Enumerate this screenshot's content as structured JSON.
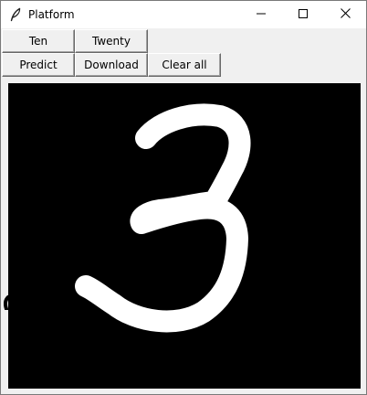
{
  "window": {
    "title": "Platform",
    "controls": {
      "minimize_icon": "minimize-icon",
      "maximize_icon": "maximize-icon",
      "close_icon": "close-icon"
    }
  },
  "buttons": {
    "ten": "Ten",
    "twenty": "Twenty",
    "predict": "Predict",
    "download": "Download",
    "clear_all": "Clear all"
  },
  "canvas": {
    "background": "#000000",
    "stroke_color": "#ffffff",
    "drawn_content": "3"
  }
}
